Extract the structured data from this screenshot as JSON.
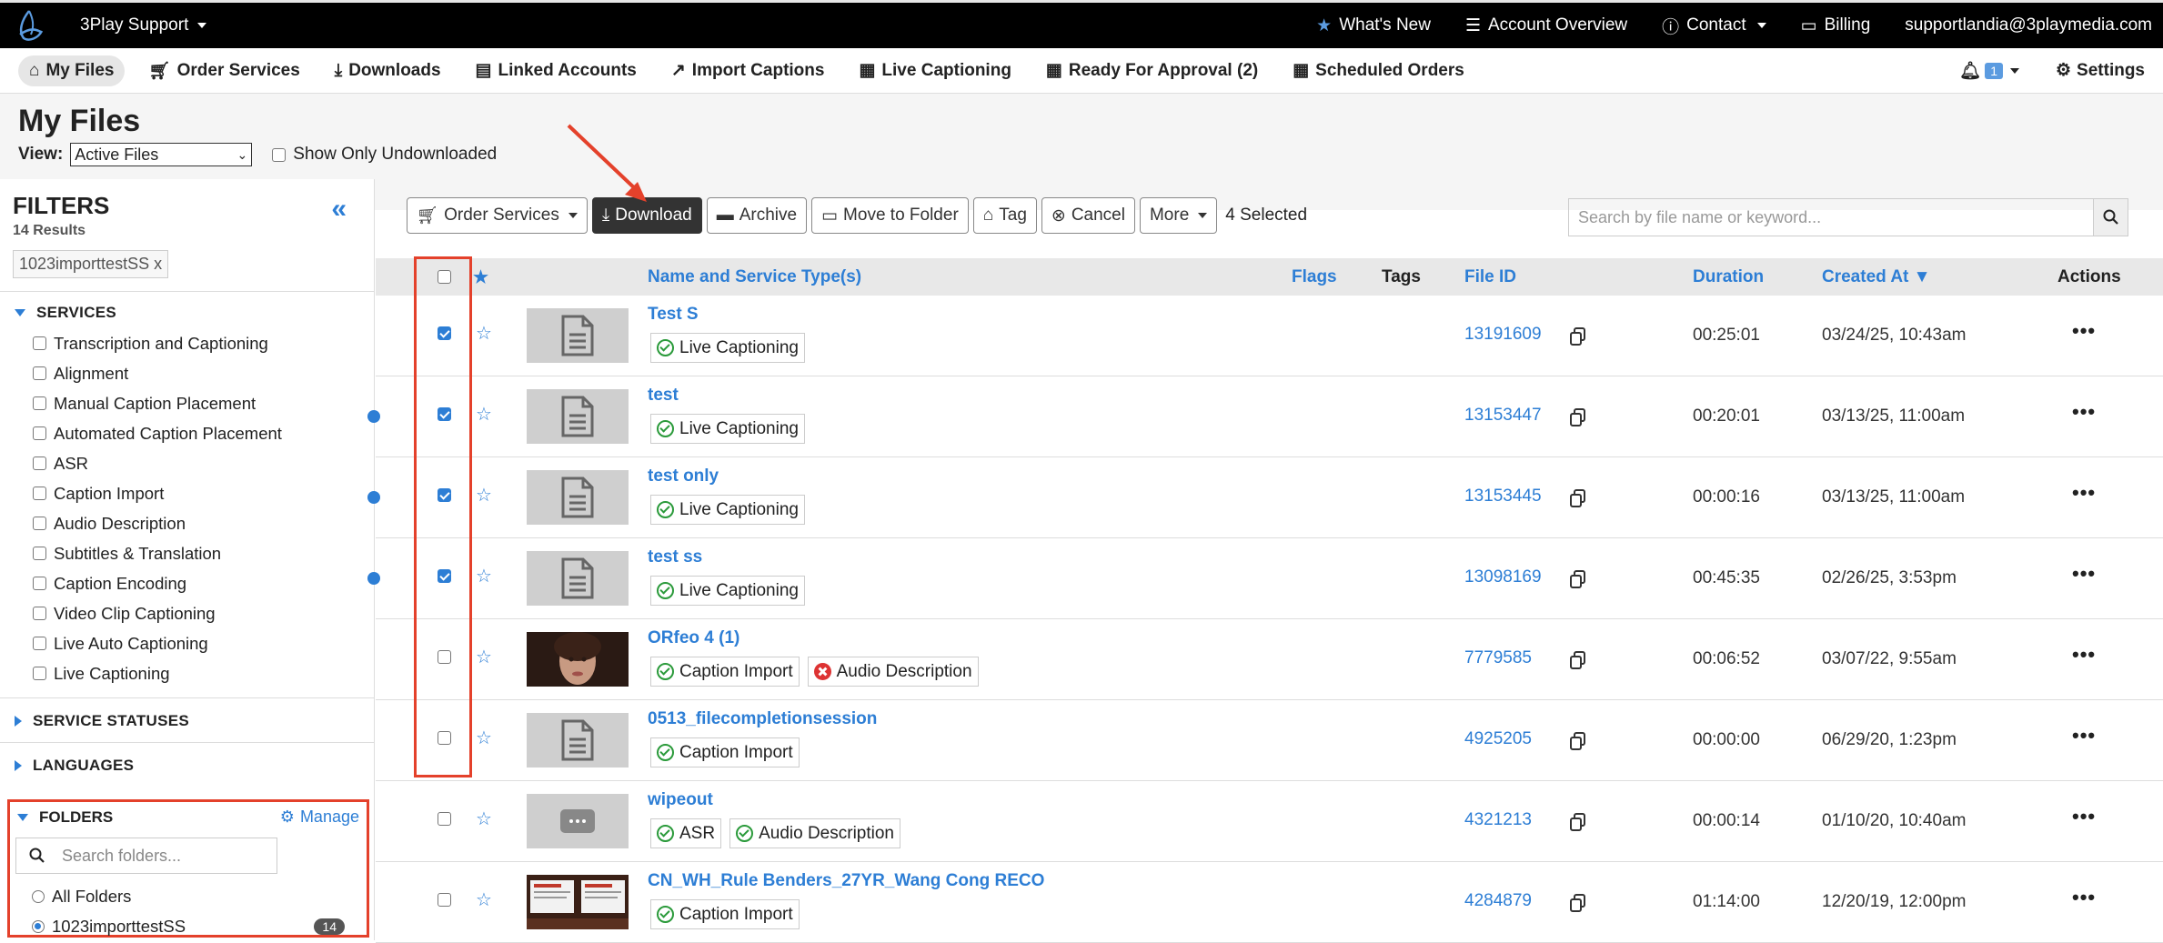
{
  "topbar": {
    "org": "3Play Support",
    "whats_new": "What's New",
    "account_overview": "Account Overview",
    "contact": "Contact",
    "billing": "Billing",
    "email": "supportlandia@3playmedia.com"
  },
  "nav": {
    "my_files": "My Files",
    "order_services": "Order Services",
    "downloads": "Downloads",
    "linked_accounts": "Linked Accounts",
    "import_captions": "Import Captions",
    "live_captioning": "Live Captioning",
    "ready_for_approval": "Ready For Approval (2)",
    "scheduled_orders": "Scheduled Orders",
    "notif_count": "1",
    "settings": "Settings"
  },
  "page": {
    "title": "My Files",
    "view_label": "View:",
    "view_value": "Active Files",
    "undownloaded_label": "Show Only Undownloaded"
  },
  "filters": {
    "title": "FILTERS",
    "results": "14 Results",
    "active_tag": "1023importtestSS x",
    "services_label": "SERVICES",
    "services": [
      "Transcription and Captioning",
      "Alignment",
      "Manual Caption Placement",
      "Automated Caption Placement",
      "ASR",
      "Caption Import",
      "Audio Description",
      "Subtitles & Translation",
      "Caption Encoding",
      "Video Clip Captioning",
      "Live Auto Captioning",
      "Live Captioning"
    ],
    "service_statuses_label": "SERVICE STATUSES",
    "languages_label": "LANGUAGES",
    "folders_label": "FOLDERS",
    "manage_label": "Manage",
    "folder_search_placeholder": "Search folders...",
    "folder_all": "All Folders",
    "folder_selected": "1023importtestSS",
    "folder_count": "14"
  },
  "toolbar": {
    "order_services": "Order Services",
    "download": "Download",
    "archive": "Archive",
    "move_to_folder": "Move to Folder",
    "tag": "Tag",
    "cancel": "Cancel",
    "more": "More",
    "selected": "4 Selected",
    "search_placeholder": "Search by file name or keyword..."
  },
  "table": {
    "headers": {
      "name": "Name and Service Type(s)",
      "flags": "Flags",
      "tags": "Tags",
      "file_id": "File ID",
      "duration": "Duration",
      "created_at": "Created At ▼",
      "actions": "Actions"
    },
    "rows": [
      {
        "name": "Test S",
        "checked": true,
        "unread": false,
        "thumb": "doc",
        "services": [
          {
            "label": "Live Captioning",
            "status": "ok"
          }
        ],
        "file_id": "13191609",
        "duration": "00:25:01",
        "created": "03/24/25, 10:43am"
      },
      {
        "name": "test",
        "checked": true,
        "unread": true,
        "thumb": "doc",
        "services": [
          {
            "label": "Live Captioning",
            "status": "ok"
          }
        ],
        "file_id": "13153447",
        "duration": "00:20:01",
        "created": "03/13/25, 11:00am"
      },
      {
        "name": "test only",
        "checked": true,
        "unread": true,
        "thumb": "doc",
        "services": [
          {
            "label": "Live Captioning",
            "status": "ok"
          }
        ],
        "file_id": "13153445",
        "duration": "00:00:16",
        "created": "03/13/25, 11:00am"
      },
      {
        "name": "test ss",
        "checked": true,
        "unread": true,
        "thumb": "doc",
        "services": [
          {
            "label": "Live Captioning",
            "status": "ok"
          }
        ],
        "file_id": "13098169",
        "duration": "00:45:35",
        "created": "02/26/25, 3:53pm"
      },
      {
        "name": "ORfeo 4 (1)",
        "checked": false,
        "unread": false,
        "thumb": "face",
        "services": [
          {
            "label": "Caption Import",
            "status": "ok"
          },
          {
            "label": "Audio Description",
            "status": "error"
          }
        ],
        "file_id": "7779585",
        "duration": "00:06:52",
        "created": "03/07/22, 9:55am"
      },
      {
        "name": "0513_filecompletionsession",
        "checked": false,
        "unread": false,
        "thumb": "doc",
        "services": [
          {
            "label": "Caption Import",
            "status": "ok"
          }
        ],
        "file_id": "4925205",
        "duration": "00:00:00",
        "created": "06/29/20, 1:23pm"
      },
      {
        "name": "wipeout",
        "checked": false,
        "unread": false,
        "thumb": "video",
        "services": [
          {
            "label": "ASR",
            "status": "ok"
          },
          {
            "label": "Audio Description",
            "status": "ok"
          }
        ],
        "file_id": "4321213",
        "duration": "00:00:14",
        "created": "01/10/20, 10:40am"
      },
      {
        "name": "CN_WH_Rule Benders_27YR_Wang Cong RECO",
        "checked": false,
        "unread": false,
        "thumb": "slides",
        "services": [
          {
            "label": "Caption Import",
            "status": "ok"
          }
        ],
        "file_id": "4284879",
        "duration": "01:14:00",
        "created": "12/20/19, 12:00pm"
      }
    ]
  },
  "colors": {
    "accent": "#2d7ed5",
    "highlight": "#e4412b",
    "ok": "#2a9a3a",
    "error": "#dd3333"
  }
}
